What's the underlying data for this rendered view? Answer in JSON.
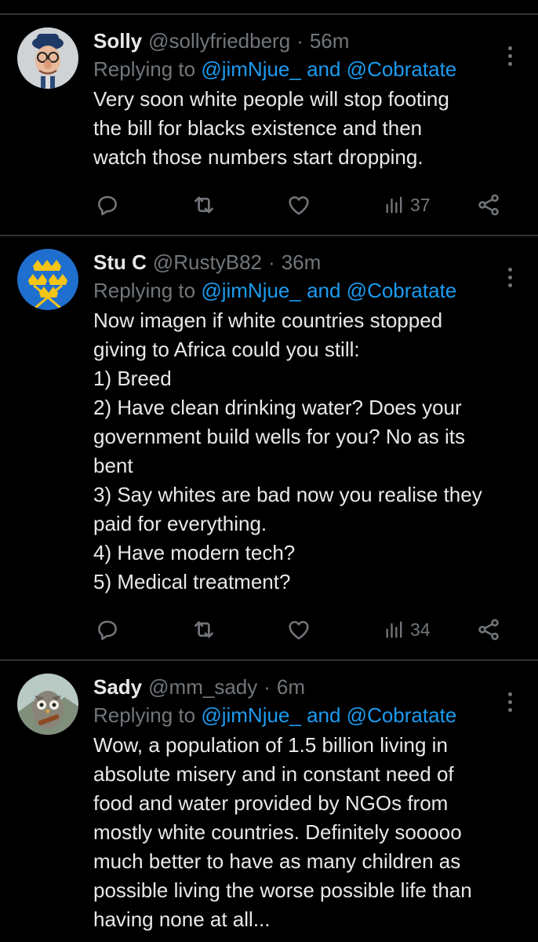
{
  "tweets": [
    {
      "name": "Solly",
      "handle": "@sollyfriedberg",
      "separator": "·",
      "time": "56m",
      "replying_prefix": "Replying to ",
      "replying_mentions": "@jimNjue_ and @Cobratate",
      "body_lines": [
        "Very soon white people will stop footing",
        "the bill for blacks existence and then",
        "watch those numbers start dropping."
      ],
      "views": "37",
      "avatar_icon": "cartoon-old-man-avatar"
    },
    {
      "name": "Stu C",
      "handle": "@RustyB82",
      "separator": "·",
      "time": "36m",
      "replying_prefix": "Replying to ",
      "replying_mentions": "@jimNjue_ and @Cobratate",
      "body_lines": [
        "Now imagen if white countries stopped",
        "giving to Africa could you still:",
        "1) Breed",
        "2) Have clean drinking water? Does your",
        "government build wells for you? No as its",
        "bent",
        "3) Say whites are bad now you realise they",
        "paid for everything.",
        "4) Have modern tech?",
        "5) Medical treatment?"
      ],
      "views": "34",
      "avatar_icon": "blue-flag-crowns-avatar"
    },
    {
      "name": "Sady",
      "handle": "@mm_sady",
      "separator": "·",
      "time": "6m",
      "replying_prefix": "Replying to ",
      "replying_mentions": "@jimNjue_ and @Cobratate",
      "body_lines": [
        "Wow, a population of 1.5 billion living in",
        "absolute misery and in constant need of",
        "food and water provided by NGOs from",
        "mostly white countries. Definitely sooooo",
        "much better to have as many children as",
        "possible living the worse possible life than",
        "having none at all..."
      ],
      "avatar_icon": "owl-avatar"
    }
  ],
  "colors": {
    "background": "#000000",
    "text": "#e7e9ea",
    "secondary": "#71767b",
    "mention": "#1d9bf0",
    "divider": "#2f3336"
  },
  "icons": [
    "reply-icon",
    "retweet-icon",
    "like-icon",
    "views-icon",
    "share-icon",
    "more-options-icon"
  ]
}
